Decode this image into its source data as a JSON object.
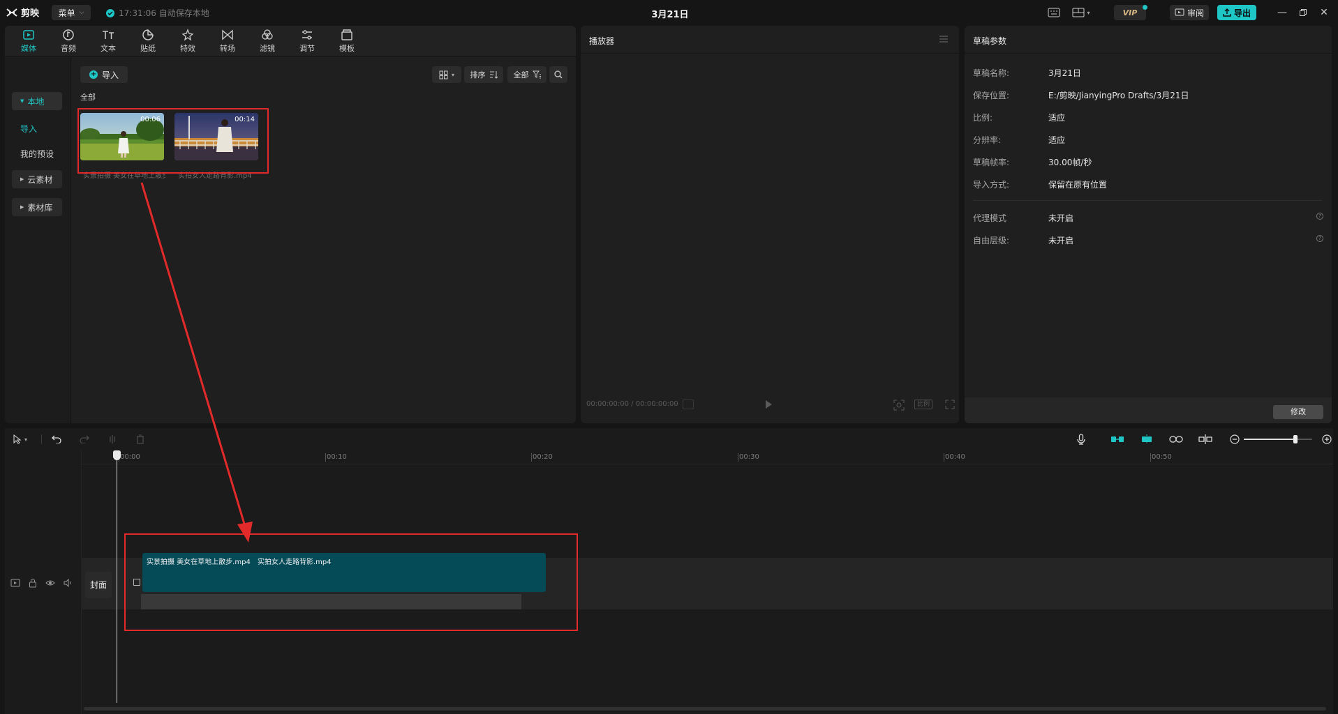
{
  "app": {
    "logo_text": "剪映",
    "menu_label": "菜单",
    "autosave_text": "17:31:06 自动保存本地",
    "document_title": "3月21日",
    "vip_label": "VIP",
    "review_label": "审阅",
    "export_label": "导出",
    "accent_color": "#1fc6c6"
  },
  "categories": [
    {
      "label": "媒体",
      "icon": "media-icon",
      "active": true
    },
    {
      "label": "音频",
      "icon": "audio-icon"
    },
    {
      "label": "文本",
      "icon": "text-icon"
    },
    {
      "label": "贴纸",
      "icon": "sticker-icon"
    },
    {
      "label": "特效",
      "icon": "effects-icon"
    },
    {
      "label": "转场",
      "icon": "transition-icon"
    },
    {
      "label": "滤镜",
      "icon": "filter-icon"
    },
    {
      "label": "调节",
      "icon": "adjust-icon"
    },
    {
      "label": "模板",
      "icon": "template-icon"
    }
  ],
  "sidebar": {
    "items": [
      {
        "label": "本地"
      },
      {
        "label": "导入"
      },
      {
        "label": "我的预设"
      },
      {
        "label": "云素材"
      },
      {
        "label": "素材库"
      }
    ]
  },
  "media": {
    "import_label": "导入",
    "sort_label": "排序",
    "filter_label": "全部",
    "all_label": "全部",
    "items": [
      {
        "name": "实景拍摄 美女在草地上散步.mp4",
        "duration": "00:06"
      },
      {
        "name": "实拍女人走路背影.mp4",
        "duration": "00:14"
      }
    ]
  },
  "player": {
    "title": "播放器",
    "time": "00:00:00:00 / 00:00:00:00",
    "ratio_label": "比例"
  },
  "params": {
    "title": "草稿参数",
    "rows": [
      {
        "key": "草稿名称:",
        "value": "3月21日"
      },
      {
        "key": "保存位置:",
        "value": "E:/剪映/JianyingPro Drafts/3月21日"
      },
      {
        "key": "比例:",
        "value": "适应"
      },
      {
        "key": "分辨率:",
        "value": "适应"
      },
      {
        "key": "草稿帧率:",
        "value": "30.00帧/秒"
      },
      {
        "key": "导入方式:",
        "value": "保留在原有位置"
      },
      {
        "key": "代理模式",
        "value": "未开启"
      },
      {
        "key": "自由层级:",
        "value": "未开启"
      }
    ],
    "modify_label": "修改"
  },
  "timeline": {
    "ticks": [
      "00:00",
      "00:10",
      "00:20",
      "00:30",
      "00:40",
      "00:50"
    ],
    "cover_label": "封面",
    "clip_names": [
      "实景拍摄 美女在草地上散步.mp4",
      "实拍女人走路背影.mp4"
    ],
    "zoom_level": 0.75
  },
  "annotation": {
    "color": "#e32a2a"
  }
}
